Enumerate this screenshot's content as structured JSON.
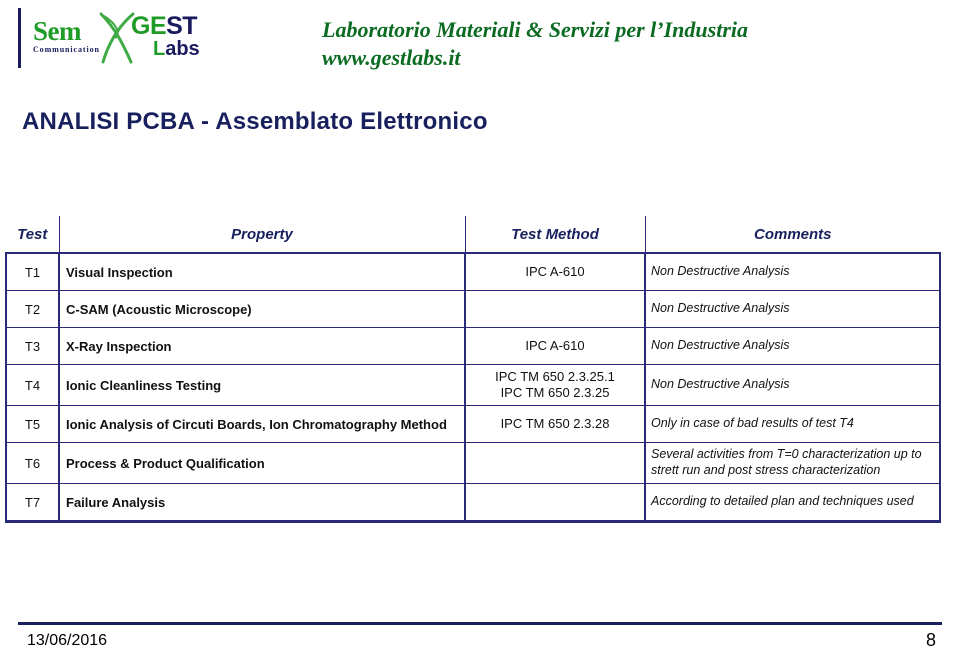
{
  "header": {
    "logo": {
      "sem_word": "Sem",
      "sem_sub": "Communication",
      "gest_ge": "GE",
      "gest_st": "ST",
      "labs_l": "L",
      "labs_abs": "abs",
      "x_icon_name": "x-swoosh-icon",
      "green": "#1f9c28",
      "navy": "#1a1a5e"
    },
    "tagline": "Laboratorio Materiali & Servizi per l’Industria",
    "website": "www.gestlabs.it",
    "tagline_color": "#0c6b22"
  },
  "page_title": "ANALISI PCBA - Assemblato Elettronico",
  "page_title_color": "#18205e",
  "table": {
    "columns": [
      {
        "key": "test",
        "label": "Test"
      },
      {
        "key": "property",
        "label": "Property"
      },
      {
        "key": "method",
        "label": "Test Method"
      },
      {
        "key": "comments",
        "label": "Comments"
      }
    ],
    "rows": [
      {
        "test": "T1",
        "property": "Visual Inspection",
        "method_lines": [
          "IPC A-610"
        ],
        "comment_lines": [
          "Non Destructive Analysis"
        ]
      },
      {
        "test": "T2",
        "property": "C-SAM (Acoustic Microscope)",
        "method_lines": [
          ""
        ],
        "comment_lines": [
          "Non Destructive Analysis"
        ]
      },
      {
        "test": "T3",
        "property": "X-Ray Inspection",
        "method_lines": [
          "IPC A-610"
        ],
        "comment_lines": [
          "Non Destructive Analysis"
        ]
      },
      {
        "test": "T4",
        "property": "Ionic Cleanliness Testing",
        "method_lines": [
          "IPC TM 650 2.3.25.1",
          "IPC TM 650 2.3.25"
        ],
        "comment_lines": [
          "Non Destructive Analysis"
        ]
      },
      {
        "test": "T5",
        "property": "Ionic Analysis of Circuti Boards, Ion Chromatography Method",
        "method_lines": [
          "IPC TM 650 2.3.28"
        ],
        "comment_lines": [
          "Only in case of bad results of test T4"
        ]
      },
      {
        "test": "T6",
        "property": "Process & Product Qualification",
        "method_lines": [
          ""
        ],
        "comment_lines": [
          "Several activities from T=0 characterization up to",
          "strett run and post stress characterization"
        ]
      },
      {
        "test": "T7",
        "property": "Failure Analysis",
        "method_lines": [
          ""
        ],
        "comment_lines": [
          "According to detailed plan and techniques used"
        ]
      }
    ]
  },
  "footer": {
    "date": "13/06/2016",
    "page_number": "8",
    "rule_color": "#18205e"
  }
}
